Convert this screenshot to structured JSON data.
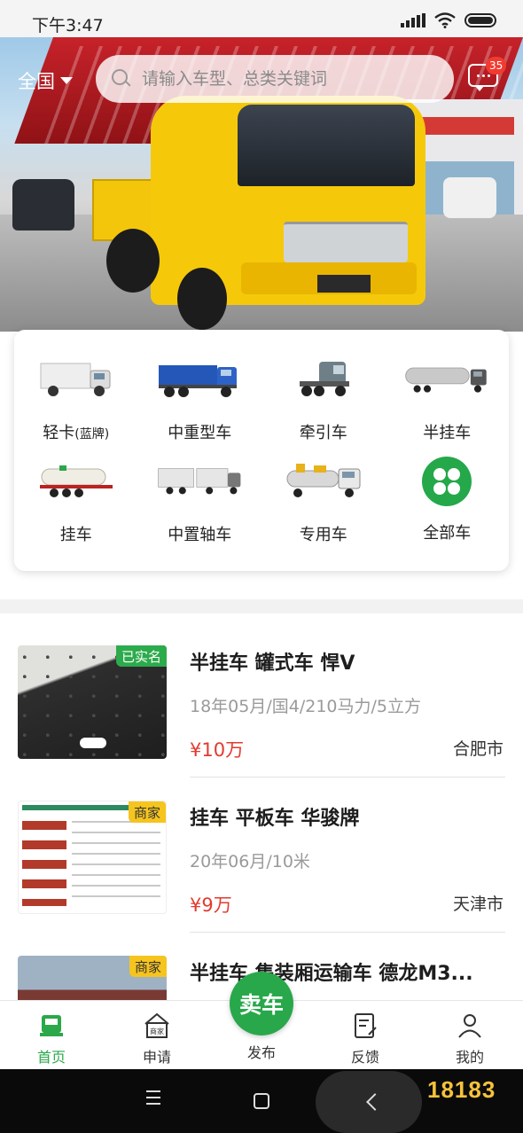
{
  "status_bar": {
    "time": "下午3:47"
  },
  "header": {
    "region": "全国",
    "search_placeholder": "请输入车型、总类关键词",
    "message_badge": "35"
  },
  "categories": [
    {
      "label": "轻卡",
      "sub": "(蓝牌)",
      "icon": "light-truck-icon"
    },
    {
      "label": "中重型车",
      "icon": "dump-truck-icon"
    },
    {
      "label": "牵引车",
      "icon": "tractor-unit-icon"
    },
    {
      "label": "半挂车",
      "icon": "tanker-semitrailer-icon"
    },
    {
      "label": "挂车",
      "icon": "trailer-icon"
    },
    {
      "label": "中置轴车",
      "icon": "center-axle-truck-icon"
    },
    {
      "label": "专用车",
      "icon": "special-vehicle-icon"
    },
    {
      "label": "全部车",
      "icon": "clover-icon"
    }
  ],
  "listings": [
    {
      "tag": "已实名",
      "tag_color": "#2cab4c",
      "title": "半挂车 罐式车 悍V",
      "spec": "18年05月/国4/210马力/5立方",
      "price": "¥10万",
      "city": "合肥市"
    },
    {
      "tag": "商家",
      "tag_color": "#f6c41e",
      "title": "挂车 平板车 华骏牌",
      "spec": "20年06月/10米",
      "price": "¥9万",
      "city": "天津市"
    },
    {
      "tag": "商家",
      "tag_color": "#f6c41e",
      "title": "半挂车 集装厢运输车 德龙M3...",
      "spec": "",
      "price": "",
      "city": ""
    }
  ],
  "bottom_nav": {
    "home": "首页",
    "apply": "申请",
    "sell": "卖车",
    "publish": "发布",
    "feedback": "反馈",
    "mine": "我的",
    "accent": "#2aa84a"
  },
  "watermark": "18183"
}
